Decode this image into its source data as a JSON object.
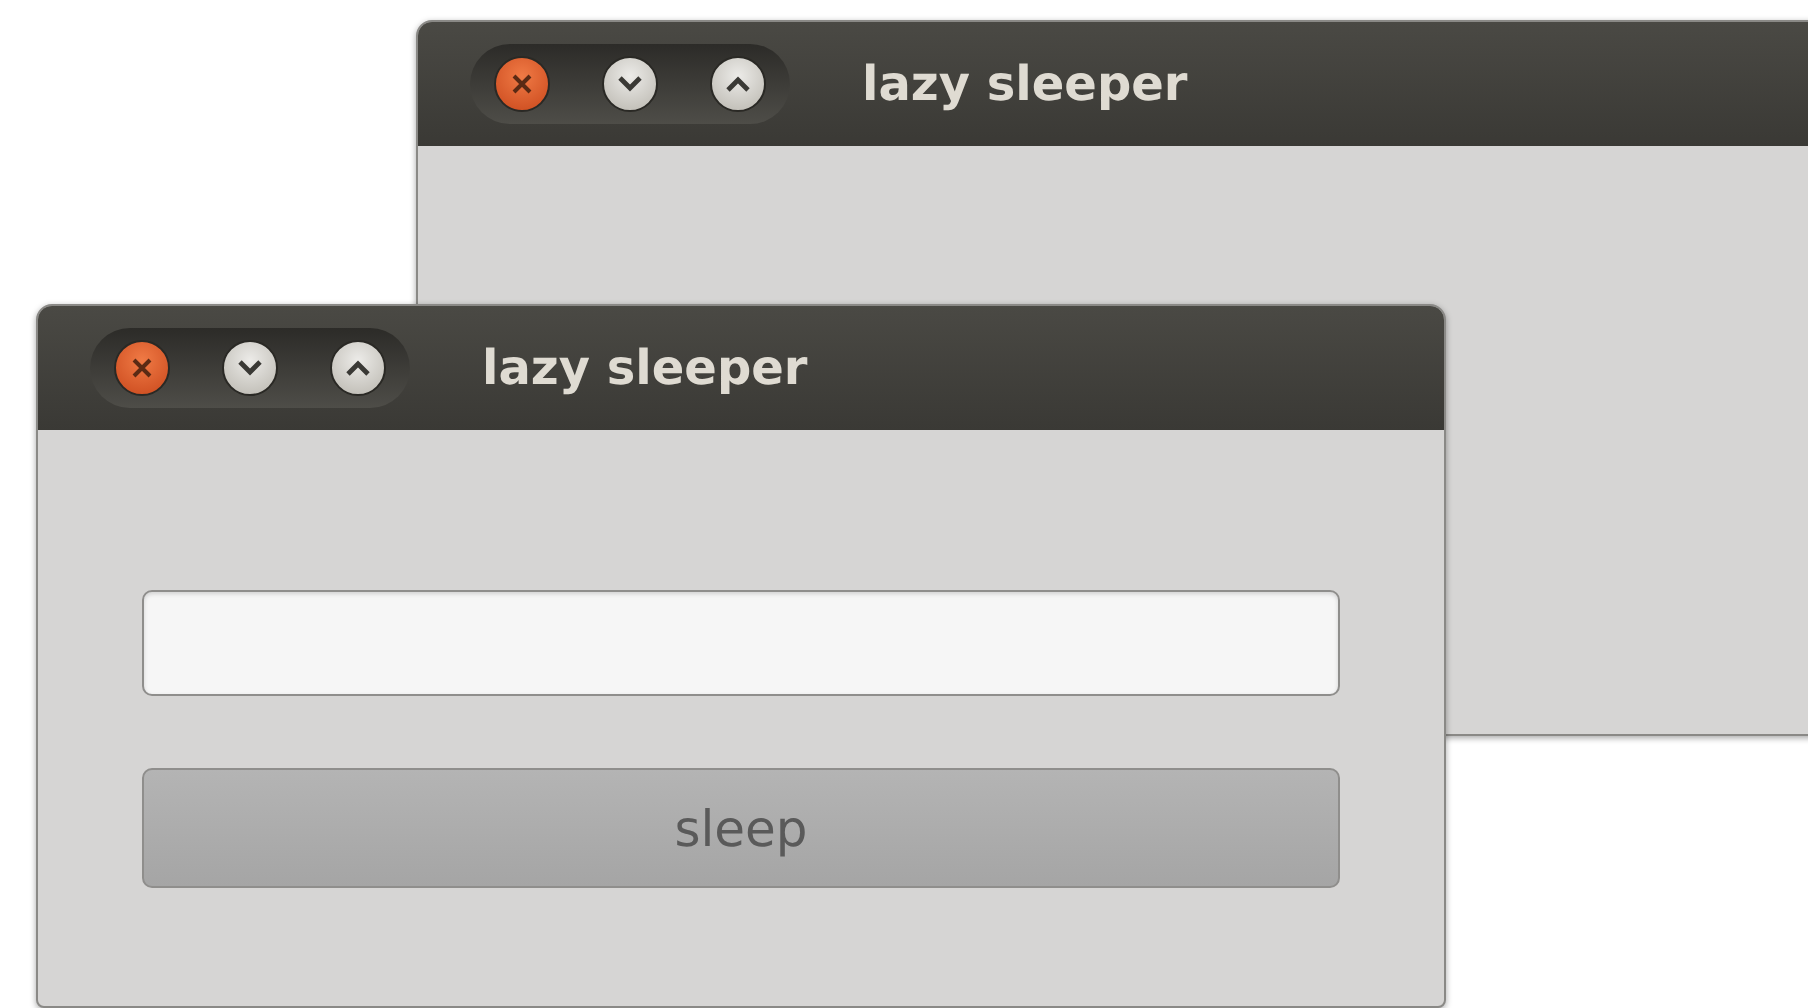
{
  "windows": [
    {
      "title": "lazy sleeper"
    },
    {
      "title": "lazy sleeper",
      "button": {
        "label": "sleep"
      }
    }
  ]
}
